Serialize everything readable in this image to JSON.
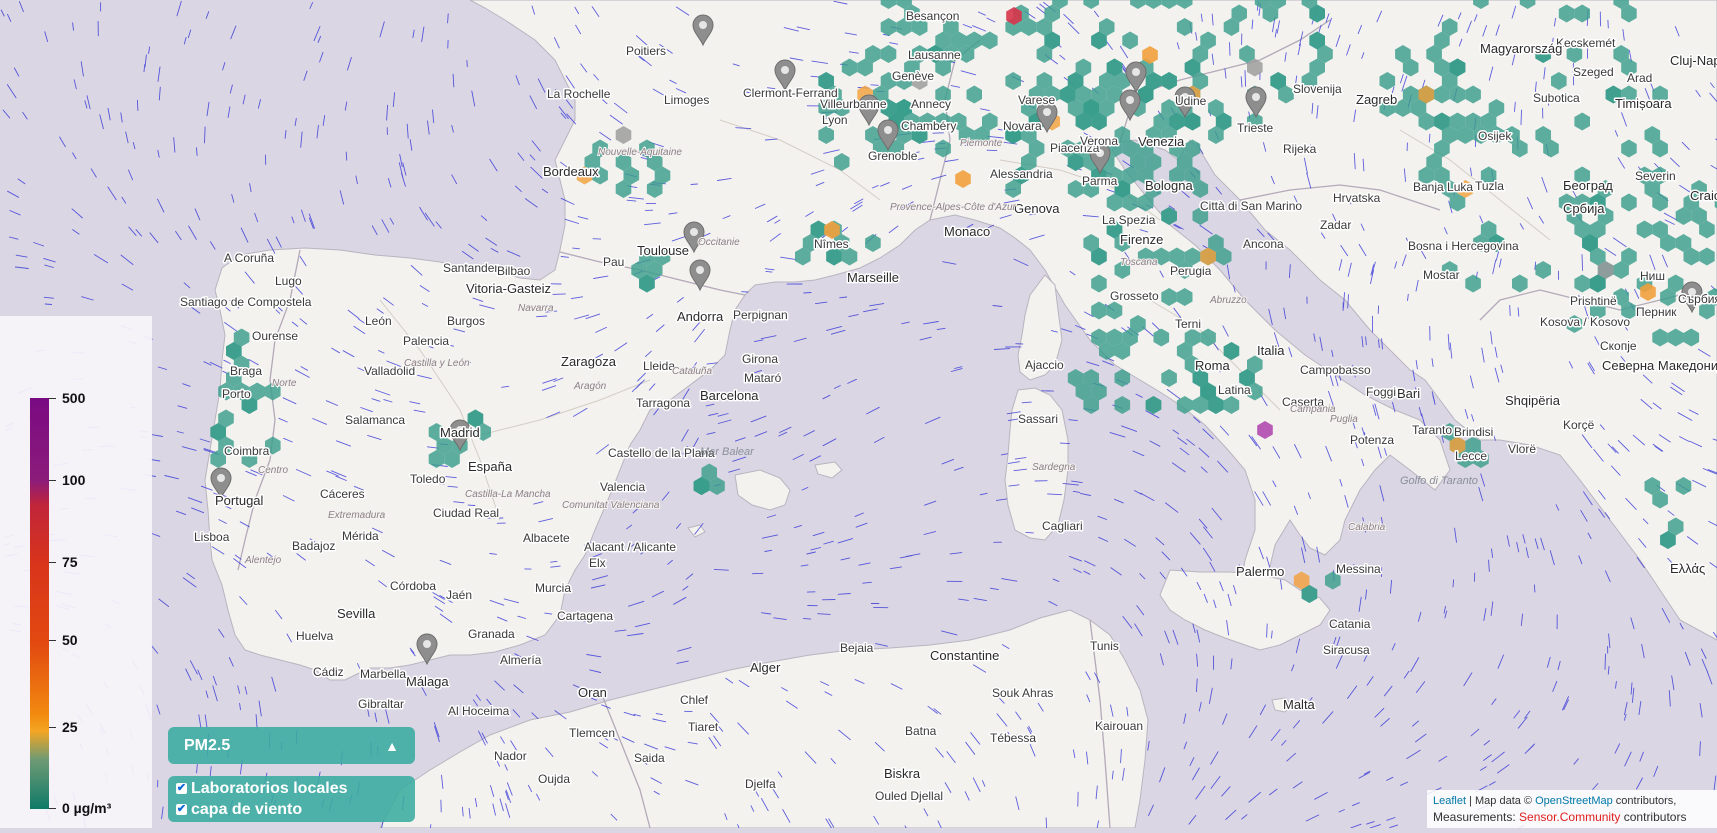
{
  "legend": {
    "labels": [
      "500",
      "100",
      "75",
      "50",
      "25",
      "0 µg/m³"
    ]
  },
  "controls": {
    "pollutant": "PM2.5",
    "arrow": "▲",
    "layers": [
      {
        "label": "Laboratorios locales",
        "checked": true
      },
      {
        "label": "capa de viento",
        "checked": true
      }
    ]
  },
  "attribution": {
    "leaflet": "Leaflet",
    "sep1": " | Map data © ",
    "osm": "OpenStreetMap",
    "contrib": " contributors,",
    "measurements": "Measurements: ",
    "sensor": "Sensor.Community",
    "contrib2": " contributors"
  },
  "colors": {
    "sensor_ok": "#3a9e8c",
    "sensor_med": "#f2a03c",
    "sensor_high": "#d8344a",
    "sensor_extreme": "#b04ab0",
    "sensor_gray": "#9a9a9a",
    "wind": "#2b2bd6",
    "sea": "#dad6e4",
    "land": "#f3f2ef"
  },
  "cities": [
    "Santander",
    "Bilbao",
    "Vitoria-Gasteiz",
    "A Coruña",
    "Lugo",
    "Santiago de Compostela",
    "Ourense",
    "León",
    "Burgos",
    "Palencia",
    "Valladolid",
    "Zaragoza",
    "Lleida",
    "Girona",
    "Barcelona",
    "Mataró",
    "Tarragona",
    "Braga",
    "Porto",
    "Coimbra",
    "Portugal",
    "Lisboa",
    "Salamanca",
    "Madrid",
    "España",
    "Toledo",
    "Cáceres",
    "Badajoz",
    "Mérida",
    "Ciudad Real",
    "Castello de la Plana",
    "Valencia",
    "Albacete",
    "Alacant / Alicante",
    "Elx",
    "Murcia",
    "Cartagena",
    "Córdoba",
    "Jaén",
    "Sevilla",
    "Huelva",
    "Granada",
    "Almería",
    "Málaga",
    "Marbella",
    "Cádiz",
    "Gibraltar",
    "Andorra",
    "Perpignan",
    "Toulouse",
    "Pau",
    "Bordeaux",
    "La Rochelle",
    "Poitiers",
    "Limoges",
    "Clermont-Ferrand",
    "Villeurbanne",
    "Lyon",
    "Grenoble",
    "Chambéry",
    "Annecy",
    "Genève",
    "Lausanne",
    "Besançon",
    "Nîmes",
    "Marseille",
    "Monaco",
    "Genova",
    "Alessandria",
    "Piacenza",
    "Novara",
    "Varese",
    "Verona",
    "Venezia",
    "Udine",
    "Trieste",
    "Parma",
    "Bologna",
    "La Spezia",
    "Firenze",
    "Città di San Marino",
    "Ancona",
    "Perugia",
    "Grosseto",
    "Terni",
    "Italia",
    "Roma",
    "Latina",
    "Campobasso",
    "Caserta",
    "Foggia",
    "Bari",
    "Potenza",
    "Taranto",
    "Brindisi",
    "Lecce",
    "Ajaccio",
    "Sassari",
    "Cagliari",
    "Palermo",
    "Messina",
    "Catania",
    "Siracusa",
    "Malta",
    "Slovenija",
    "Zagreb",
    "Rijeka",
    "Zadar",
    "Hrvatska",
    "Banja Luka",
    "Tuzla",
    "Bosna i Hercegovina",
    "Mostar",
    "Osijek",
    "Subotica",
    "Szeged",
    "Kecskemét",
    "Magyarország",
    "Timișoara",
    "Arad",
    "Cluj-Nap",
    "Београд",
    "Србија",
    "Severin",
    "Craio",
    "Prishtinë",
    "Kosova / Kosovo",
    "Ниш",
    "Перник",
    "Сърбия",
    "Северна Македонија",
    "Скопје",
    "Shqipëria",
    "Vlorë",
    "Korçë",
    "Ελλάς",
    "Alger",
    "Bejaia",
    "Constantine",
    "Oran",
    "Chlef",
    "Tiaret",
    "Tlemcen",
    "Saida",
    "Oujda",
    "Nador",
    "Al Hoceima",
    "Tunis",
    "Souk Ahras",
    "Biskra",
    "Batna",
    "Tébessa",
    "Kairouan",
    "Djelfa",
    "Ouled Djellal"
  ]
}
